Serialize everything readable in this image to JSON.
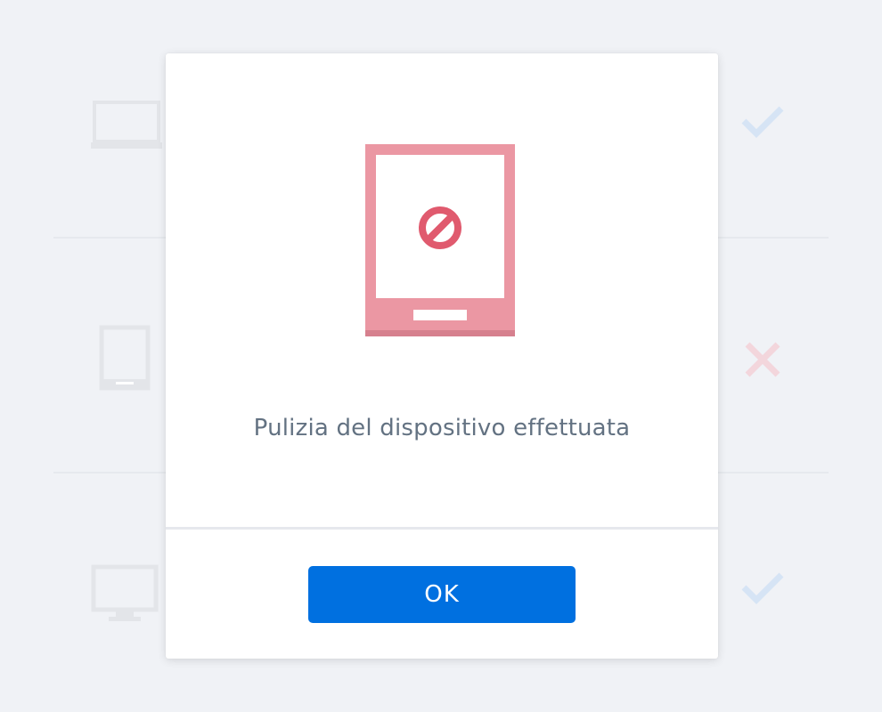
{
  "background_list": {
    "rows": [
      {
        "device_icon": "laptop-icon",
        "status_icon": "check-icon"
      },
      {
        "device_icon": "tablet-icon",
        "status_icon": "cross-icon"
      },
      {
        "device_icon": "desktop-icon",
        "status_icon": "check-icon"
      }
    ]
  },
  "dialog": {
    "illustration_icon": "tablet-blocked-icon",
    "message": "Pulizia del dispositivo effettuata",
    "ok_label": "OK"
  },
  "colors": {
    "page_background": "#f0f2f6",
    "primary_button": "#0070e0",
    "message_text": "#637282",
    "illustration_pink": "#eb97a3",
    "blocked_red": "#e05a6e",
    "check_blue": "#d6e4f5",
    "cross_pink": "#f3d6dc",
    "device_gray": "#e3e5e9"
  }
}
